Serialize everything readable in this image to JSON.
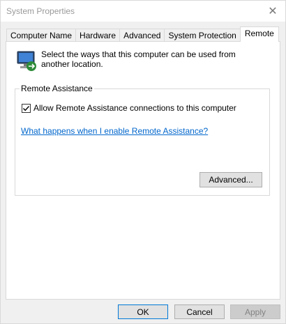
{
  "window": {
    "title": "System Properties",
    "close_glyph": "✕"
  },
  "tabs": [
    {
      "label": "Computer Name",
      "active": false
    },
    {
      "label": "Hardware",
      "active": false
    },
    {
      "label": "Advanced",
      "active": false
    },
    {
      "label": "System Protection",
      "active": false
    },
    {
      "label": "Remote",
      "active": true
    }
  ],
  "remote": {
    "intro": "Select the ways that this computer can be used from another location.",
    "icon": "remote-computer-icon",
    "remote_assistance": {
      "group_label": "Remote Assistance",
      "checkbox_label": "Allow Remote Assistance connections to this computer",
      "checkbox_checked": true,
      "help_link": "What happens when I enable Remote Assistance?",
      "advanced_button": "Advanced..."
    }
  },
  "footer": {
    "ok": "OK",
    "cancel": "Cancel",
    "apply": "Apply",
    "apply_enabled": false
  }
}
